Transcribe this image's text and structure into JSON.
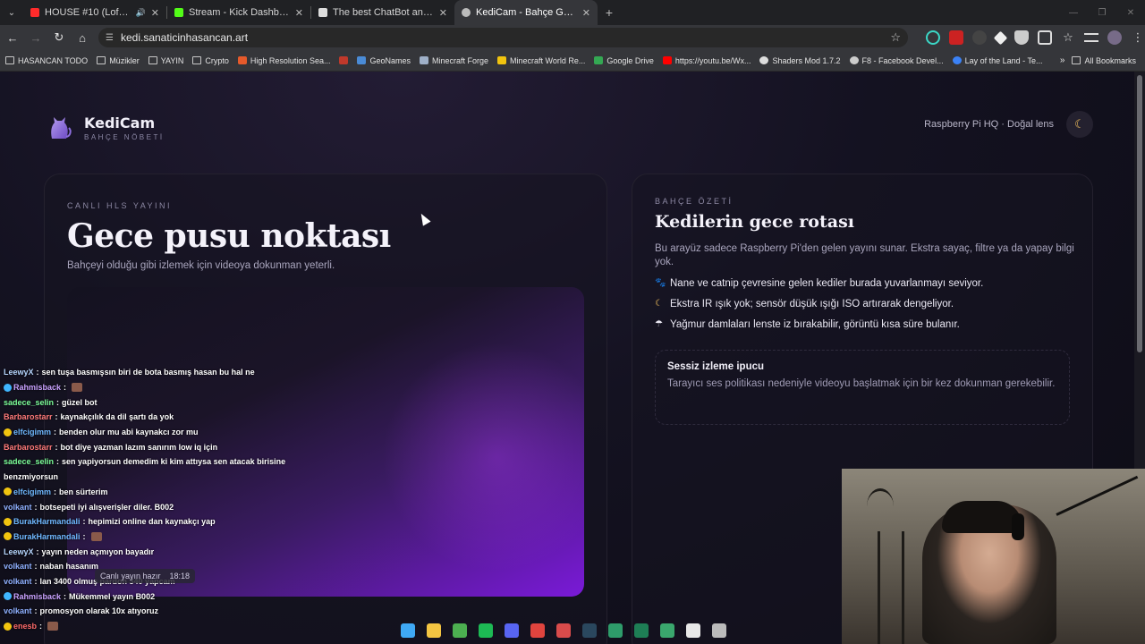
{
  "browser": {
    "tabs": [
      {
        "title": "HOUSE #10 (Lofi Deep Hou…",
        "favicon_color": "#ff2b2b",
        "active": false
      },
      {
        "title": "Stream - Kick Dashboard",
        "favicon_color": "#53fc18",
        "active": false
      },
      {
        "title": "The best ChatBot and Widgets",
        "favicon_color": "#dddddd",
        "active": false
      },
      {
        "title": "KediCam - Bahçe Gözetimi",
        "favicon_color": "#bbbbbb",
        "active": true
      }
    ],
    "url": "kedi.sanaticinhasancan.art",
    "bookmarks": [
      {
        "label": "HASANCAN TODO",
        "type": "folder"
      },
      {
        "label": "Müzikler",
        "type": "folder"
      },
      {
        "label": "YAYIN",
        "type": "folder"
      },
      {
        "label": "Crypto",
        "type": "folder"
      },
      {
        "label": "High Resolution Sea...",
        "type": "site",
        "color": "#e65a2b"
      },
      {
        "label": "",
        "type": "site",
        "color": "#c0392b"
      },
      {
        "label": "GeoNames",
        "type": "site",
        "color": "#4a8bd6"
      },
      {
        "label": "Minecraft Forge",
        "type": "site",
        "color": "#9fb0c8"
      },
      {
        "label": "Minecraft World Re...",
        "type": "site",
        "color": "#f1c40f"
      },
      {
        "label": "Google Drive",
        "type": "site",
        "color": "#34a853"
      },
      {
        "label": "https://youtu.be/Wx...",
        "type": "site",
        "color": "#ff0000"
      },
      {
        "label": "Shaders Mod 1.7.2",
        "type": "site",
        "color": "#dddddd"
      },
      {
        "label": "F8 - Facebook Devel...",
        "type": "site",
        "color": "#cccccc"
      },
      {
        "label": "Lay of the Land - Te...",
        "type": "site",
        "color": "#3b82f6"
      }
    ],
    "all_bookmarks": "All Bookmarks"
  },
  "site": {
    "brand_name": "KediCam",
    "brand_sub": "BAHÇE NÖBETİ",
    "header_info": "Raspberry Pi HQ · Doğal lens",
    "theme_icon": "☾"
  },
  "live": {
    "eyebrow": "CANLI HLS YAYINI",
    "title": "Gece pusu noktası",
    "lead": "Bahçeyi olduğu gibi izlemek için videoya dokunman yeterli."
  },
  "summary": {
    "eyebrow": "BAHÇE ÖZETİ",
    "title": "Kedilerin gece rotası",
    "desc": "Bu arayüz sadece Raspberry Pi'den gelen yayını sunar. Ekstra sayaç, filtre ya da yapay bilgi yok.",
    "facts": [
      {
        "icon": "🐾",
        "text": "Nane ve catnip çevresine gelen kediler burada yuvarlanmayı seviyor."
      },
      {
        "icon": "☾",
        "text": "Ekstra IR ışık yok; sensör düşük ışığı ISO artırarak dengeliyor."
      },
      {
        "icon": "☂",
        "text": "Yağmur damlaları lenste iz bırakabilir, görüntü kısa süre bulanır."
      }
    ],
    "tip_title": "Sessiz izleme ipucu",
    "tip_body": "Tarayıcı ses politikası nedeniyle videoyu başlatmak için bir kez dokunman gerekebilir."
  },
  "chat": [
    {
      "user": "LeewyX",
      "color": "#b7d6ff",
      "text": "sen tuşa basmışsın biri de bota basmış hasan bu hal ne",
      "badge": ""
    },
    {
      "user": "Rahmisback",
      "color": "#c9a2ff",
      "text": "",
      "badge": "#3fb6ff",
      "emote": true
    },
    {
      "user": "sadece_selin",
      "color": "#7dff9a",
      "text": "güzel bot",
      "badge": ""
    },
    {
      "user": "Barbarostarr",
      "color": "#ff7a7a",
      "text": "kaynakçılık da dil şartı da yok",
      "badge": ""
    },
    {
      "user": "elfcigimm",
      "color": "#6fb8ff",
      "text": "benden olur mu abi kaynakcı zor mu",
      "badge": "#f1c40f"
    },
    {
      "user": "Barbarostarr",
      "color": "#ff7a7a",
      "text": "bot diye yazman lazım sanırım low iq için",
      "badge": ""
    },
    {
      "user": "sadece_selin",
      "color": "#7dff9a",
      "text": "sen yapiyorsun demedim ki kim attıysa sen atacak birisine",
      "badge": ""
    },
    {
      "user": "",
      "color": "#ffffff",
      "text": "benzmiyorsun",
      "badge": ""
    },
    {
      "user": "elfcigimm",
      "color": "#6fb8ff",
      "text": "ben sürterim",
      "badge": "#f1c40f"
    },
    {
      "user": "volkant",
      "color": "#8fb0ff",
      "text": "botsepeti iyi alışverişler diler. B002",
      "badge": ""
    },
    {
      "user": "BurakHarmandali",
      "color": "#6fb8ff",
      "text": "hepimizi online dan kaynakçı yap",
      "badge": "#f1c40f"
    },
    {
      "user": "BurakHarmandali",
      "color": "#6fb8ff",
      "text": "",
      "badge": "#f1c40f",
      "emote": true
    },
    {
      "user": "LeewyX",
      "color": "#b7d6ff",
      "text": "yayın neden açmıyon bayadır",
      "badge": ""
    },
    {
      "user": "volkant",
      "color": "#8fb0ff",
      "text": "naban hasanım",
      "badge": ""
    },
    {
      "user": "volkant",
      "color": "#8fb0ff",
      "text": "lan 3400 olmuş pardon 340 yapcam",
      "badge": ""
    },
    {
      "user": "Rahmisback",
      "color": "#c9a2ff",
      "text": "Mükemmel yayın B002",
      "badge": "#3fb6ff"
    },
    {
      "user": "volkant",
      "color": "#8fb0ff",
      "text": "promosyon olarak 10x atıyoruz",
      "badge": ""
    },
    {
      "user": "enesb",
      "color": "#ff6b6b",
      "text": "",
      "badge": "#f1c40f",
      "emote": true
    }
  ],
  "overlay": {
    "status": "Canlı yayın hazır",
    "time": "18:18"
  },
  "taskbar_icons": [
    {
      "name": "windows-start-icon",
      "color": "#3fa9f5"
    },
    {
      "name": "file-explorer-icon",
      "color": "#f4c542"
    },
    {
      "name": "chrome-icon",
      "color": "#4caf50"
    },
    {
      "name": "spotify-icon",
      "color": "#1db954"
    },
    {
      "name": "discord-icon",
      "color": "#5865f2"
    },
    {
      "name": "app-red-icon",
      "color": "#e0443e"
    },
    {
      "name": "app-stripe-icon",
      "color": "#d94b4b"
    },
    {
      "name": "steam-icon",
      "color": "#2a475e"
    },
    {
      "name": "app-green-icon",
      "color": "#2e9c6a"
    },
    {
      "name": "app-arrow-icon",
      "color": "#1e7e55"
    },
    {
      "name": "app-photo-icon",
      "color": "#3aa76d"
    },
    {
      "name": "app-epic-icon",
      "color": "#e8e8e8"
    },
    {
      "name": "obs-icon",
      "color": "#bbbbbb"
    }
  ]
}
